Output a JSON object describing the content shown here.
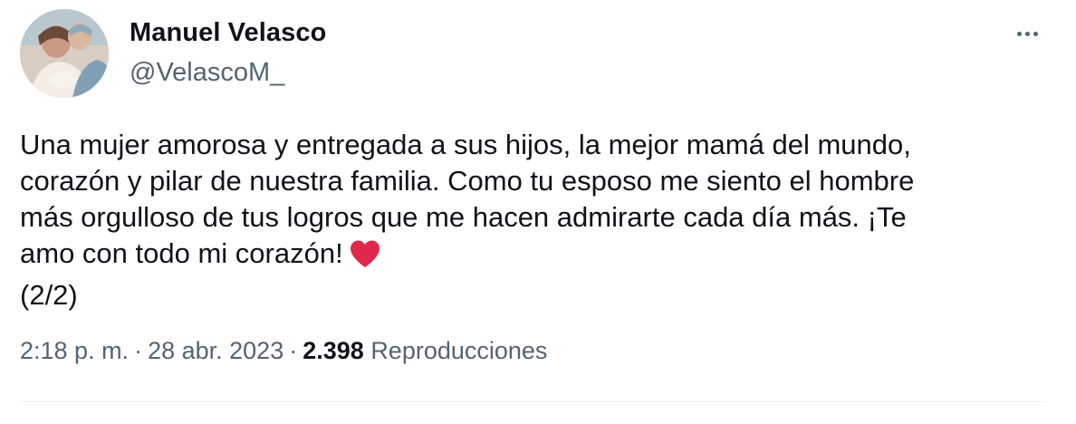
{
  "author": {
    "name": "Manuel Velasco",
    "handle": "@VelascoM_"
  },
  "tweet": {
    "lines": [
      "Una mujer amorosa y entregada a sus hijos, la mejor mamá del mundo,",
      "corazón y pilar de nuestra familia. Como tu esposo me siento el hombre",
      "más orgulloso de tus logros que me hacen admirarte cada día más. ¡Te",
      "amo con todo mi corazón!",
      "(2/2)"
    ],
    "emoji": "red-heart-icon"
  },
  "meta": {
    "time": "2:18 p. m.",
    "separator": "·",
    "date": "28 abr. 2023",
    "views_count": "2.398",
    "views_label": "Reproducciones"
  },
  "colors": {
    "text": "#0f1419",
    "secondary": "#536471",
    "heart": "#e0284a",
    "divider": "#eff3f4"
  },
  "menu": {
    "icon": "more-options-icon"
  }
}
